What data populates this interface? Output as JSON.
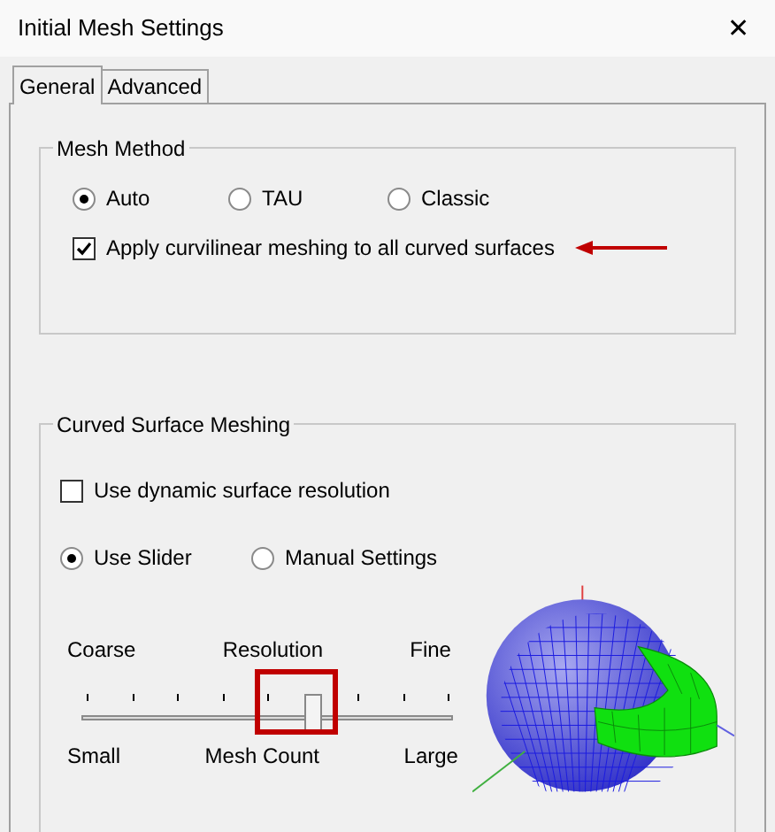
{
  "window": {
    "title": "Initial Mesh Settings",
    "close": "✕"
  },
  "tabs": [
    {
      "label": "General",
      "selected": true
    },
    {
      "label": "Advanced",
      "selected": false
    }
  ],
  "mesh_method": {
    "title": "Mesh Method",
    "options": [
      {
        "label": "Auto",
        "selected": true
      },
      {
        "label": "TAU",
        "selected": false
      },
      {
        "label": "Classic",
        "selected": false
      }
    ],
    "curvilinear": {
      "label": "Apply curvilinear meshing to all curved surfaces",
      "checked": true
    }
  },
  "curved_surface_meshing": {
    "title": "Curved Surface Meshing",
    "dynamic_resolution": {
      "label": "Use dynamic surface resolution",
      "checked": false
    },
    "modes": [
      {
        "label": "Use Slider",
        "selected": true
      },
      {
        "label": "Manual Settings",
        "selected": false
      }
    ],
    "slider": {
      "top_labels": [
        "Coarse",
        "Resolution",
        "Fine"
      ],
      "bottom_labels": [
        "Small",
        "Mesh Count",
        "Large"
      ],
      "level": 0.625
    }
  }
}
